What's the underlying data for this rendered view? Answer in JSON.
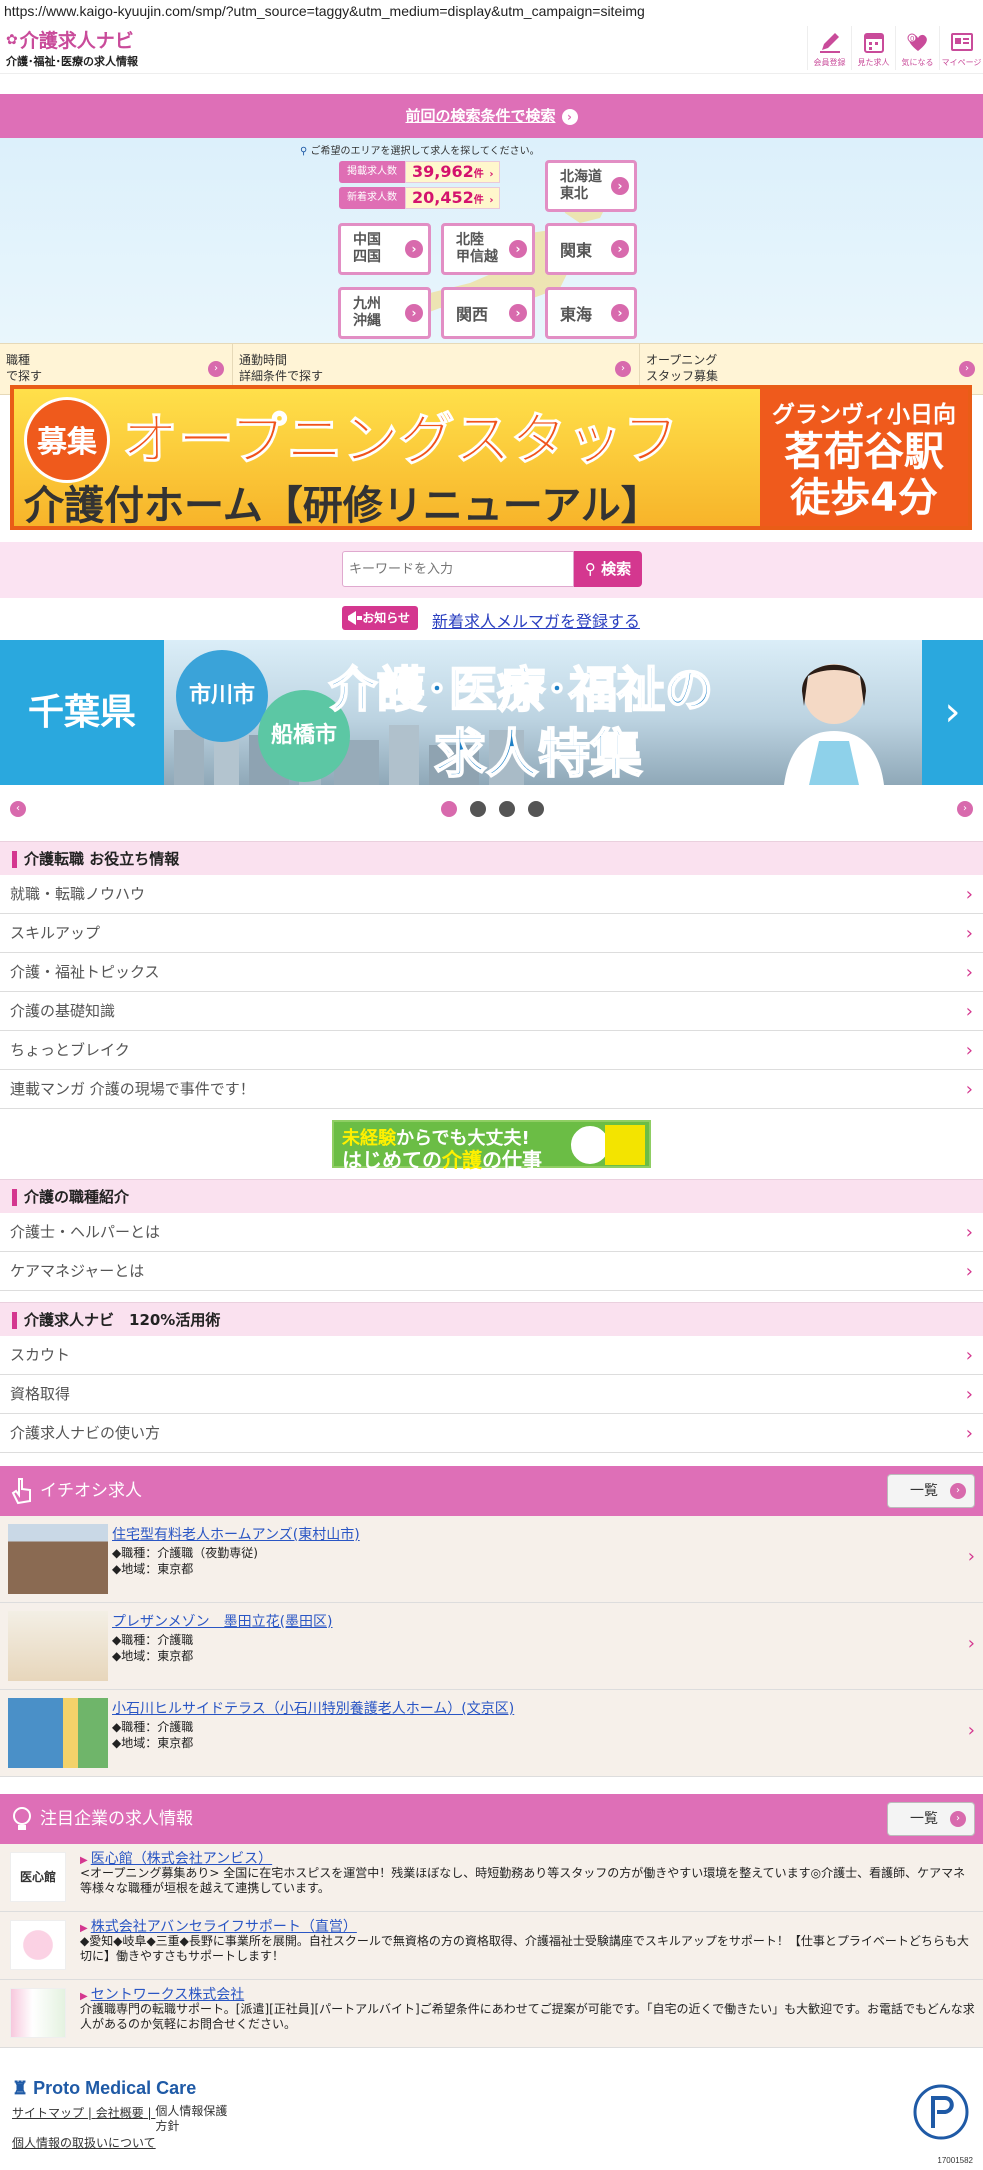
{
  "browser": {
    "url": "https://www.kaigo-kyuujin.com/smp/?utm_source=taggy&utm_medium=display&utm_campaign=siteimg"
  },
  "header": {
    "logo_main": "介護求人ナビ",
    "logo_sub": "介護･福祉･医療の求人情報",
    "icons": [
      {
        "name": "pen-icon",
        "label": "会員登録"
      },
      {
        "name": "calendar-icon",
        "label": "見た求人"
      },
      {
        "name": "heart-icon",
        "label": "気になる"
      },
      {
        "name": "mypage-icon",
        "label": "マイページ"
      }
    ]
  },
  "prev_search": {
    "label": "前回の検索条件で検索"
  },
  "area": {
    "prompt": "ご希望のエリアを選択して求人を探してください。",
    "stats": [
      {
        "label": "掲載求人数",
        "value": "39,962",
        "unit": "件"
      },
      {
        "label": "新着求人数",
        "value": "20,452",
        "unit": "件"
      }
    ],
    "regions": [
      "北海道\n東北",
      "中国\n四国",
      "北陸\n甲信越",
      "関東",
      "九州\n沖縄",
      "関西",
      "東海"
    ]
  },
  "subnav": [
    {
      "label": "職種\nで探す"
    },
    {
      "label": "通勤時間\n詳細条件で探す"
    },
    {
      "label": "オープニング\nスタッフ募集"
    }
  ],
  "banner": {
    "badge": "募集",
    "headline": "オープニングスタッフ",
    "subline": "介護付ホーム【研修リニューアル】",
    "facility": "グランヴィ小日向",
    "station": "茗荷谷駅",
    "walk": "徒歩4分"
  },
  "search": {
    "placeholder": "キーワードを入力",
    "button": "検索"
  },
  "notice": {
    "tag": "お知らせ",
    "link": "新着求人メルマガを登録する"
  },
  "carousel": {
    "pref": "千葉県",
    "city1": "市川市",
    "city2": "船橋市",
    "line1": "介護･医療･福祉の",
    "line2": "求人特集",
    "dots": 4,
    "active": 0
  },
  "useful": {
    "title": "介護転職 お役立ち情報",
    "items": [
      "就職・転職ノウハウ",
      "スキルアップ",
      "介護・福祉トピックス",
      "介護の基礎知識",
      "ちょっとブレイク",
      "連載マンガ 介護の現場で事件です！"
    ]
  },
  "midbanner": {
    "l1a": "未経験",
    "l1b": "からでも大丈夫!",
    "l2a": "はじめての",
    "l2b": "介護",
    "l2c": "の仕事"
  },
  "jobtypes": {
    "title": "介護の職種紹介",
    "items": [
      "介護士・ヘルパーとは",
      "ケアマネジャーとは"
    ]
  },
  "howto": {
    "title": "介護求人ナビ　120%活用術",
    "items": [
      "スカウト",
      "資格取得",
      "介護求人ナビの使い方"
    ]
  },
  "pickup": {
    "title": "イチオシ求人",
    "all": "一覧",
    "jobs": [
      {
        "title": "住宅型有料老人ホームアンズ(東村山市)",
        "type": "◆職種：介護職（夜勤専従)",
        "area": "◆地域：東京都"
      },
      {
        "title": "プレザンメゾン　墨田立花(墨田区)",
        "type": "◆職種：介護職",
        "area": "◆地域：東京都"
      },
      {
        "title": "小石川ヒルサイドテラス（小石川特別養護老人ホーム）(文京区)",
        "type": "◆職種：介護職",
        "area": "◆地域：東京都"
      }
    ]
  },
  "companies": {
    "title": "注目企業の求人情報",
    "all": "一覧",
    "items": [
      {
        "logo": "医心館",
        "title": "医心館（株式会社アンビス）",
        "desc": "<オープニング募集あり> 全国に在宅ホスピスを運営中！残業ほぼなし、時短勤務あり等スタッフの方が働きやすい環境を整えています◎介護士、看護師、ケアマネ等様々な職種が垣根を越えて連携しています。"
      },
      {
        "logo": "",
        "title": "株式会社アバンセライフサポート（直営）",
        "desc": "◆愛知◆岐阜◆三重◆長野に事業所を展開。自社スクールで無資格の方の資格取得、介護福祉士受験講座でスキルアップをサポート！【仕事とプライベートどちらも大切に】働きやすさもサポートします！"
      },
      {
        "logo": "",
        "title": "セントワークス株式会社",
        "desc": "介護職専門の転職サポート。[派遣][正社員][パートアルバイト]ご希望条件にあわせてご提案が可能です。「自宅の近くで働きたい」も大歓迎です。お電話でもどんな求人があるのか気軽にお問合せください。"
      }
    ]
  },
  "footer": {
    "brand": "Proto Medical Care",
    "links": [
      "サイトマップ",
      "会社概要",
      "個人情報保護\n方針",
      "個人情報の取扱いについて"
    ],
    "privacy_id": "17001582"
  },
  "colors": {
    "pink": "#de6fb7",
    "accent": "#d4378f",
    "sky": "#2aa8de"
  }
}
